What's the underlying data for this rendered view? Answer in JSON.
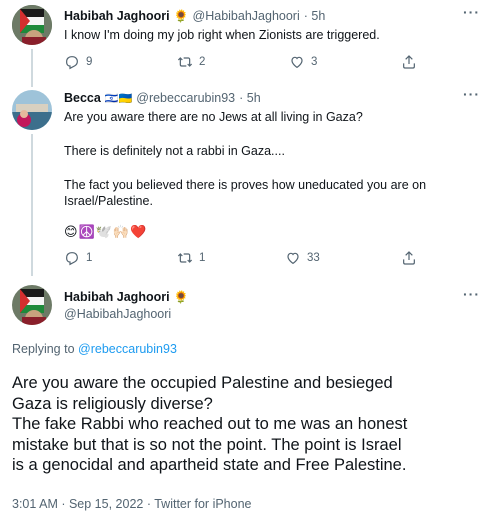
{
  "tweet1": {
    "name": "Habibah Jaghoori",
    "name_emoji": "🌻",
    "handle": "@HabibahJaghoori",
    "time": "· 5h",
    "text": "I know I'm doing my job right when Zionists are triggered.",
    "replies": "9",
    "retweets": "2",
    "likes": "3"
  },
  "tweet2": {
    "name": "Becca",
    "flags": "🇮🇱🇺🇦",
    "handle": "@rebeccarubin93",
    "time": "· 5h",
    "line1": "Are you aware there are no Jews at all living in Gaza?",
    "line2": "There is definitely not a rabbi in Gaza....",
    "line3": "The fact you believed there is proves how uneducated you are on",
    "line4": "Israel/Palestine.",
    "emojis": "😊☮️🕊️🙌🏻❤️",
    "replies": "1",
    "retweets": "1",
    "likes": "33"
  },
  "main": {
    "name": "Habibah Jaghoori",
    "name_emoji": "🌻",
    "handle": "@HabibahJaghoori",
    "replying_prefix": "Replying to",
    "replying_handle": "@rebeccarubin93",
    "line1": "Are you aware the occupied Palestine and besieged",
    "line2": "Gaza is religiously diverse?",
    "line3": "The fake Rabbi who reached out to me was an honest",
    "line4": "mistake but that is so not the point. The point is Israel",
    "line5": "is a genocidal and apartheid state and Free Palestine.",
    "timestamp": "3:01 AM · Sep 15, 2022 · Twitter for iPhone"
  },
  "more_label": "···",
  "colors": {
    "link": "#1d9bf0",
    "muted": "#536471",
    "text": "#0f1419",
    "line": "#cfd9de"
  }
}
